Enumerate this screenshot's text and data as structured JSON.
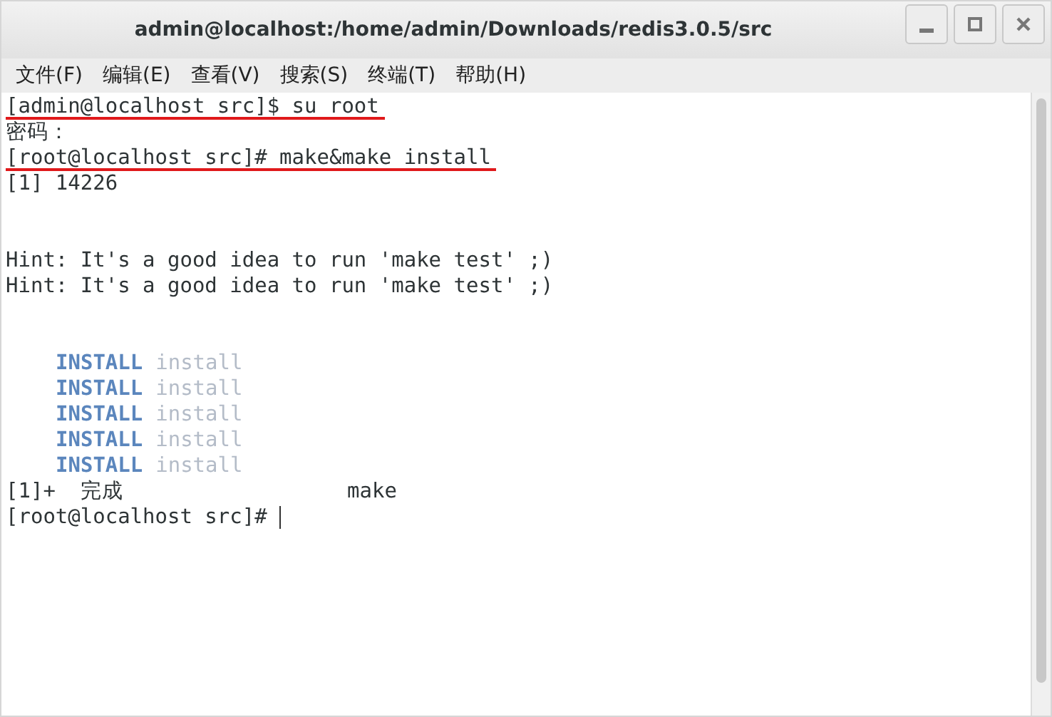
{
  "window": {
    "title": "admin@localhost:/home/admin/Downloads/redis3.0.5/src"
  },
  "menu": [
    "文件(F)",
    "编辑(E)",
    "查看(V)",
    "搜索(S)",
    "终端(T)",
    "帮助(H)"
  ],
  "terminal": {
    "lines": [
      {
        "kind": "underlined",
        "text": "[admin@localhost src]$ su root"
      },
      {
        "kind": "plain",
        "text": "密码："
      },
      {
        "kind": "underlined",
        "text": "[root@localhost src]# make&make install"
      },
      {
        "kind": "plain",
        "text": "[1] 14226"
      },
      {
        "kind": "blank"
      },
      {
        "kind": "blank"
      },
      {
        "kind": "plain",
        "text": "Hint: It's a good idea to run 'make test' ;)"
      },
      {
        "kind": "plain",
        "text": "Hint: It's a good idea to run 'make test' ;)"
      },
      {
        "kind": "blank"
      },
      {
        "kind": "blank"
      },
      {
        "kind": "install",
        "label": "INSTALL",
        "text": "install"
      },
      {
        "kind": "install",
        "label": "INSTALL",
        "text": "install"
      },
      {
        "kind": "install",
        "label": "INSTALL",
        "text": "install"
      },
      {
        "kind": "install",
        "label": "INSTALL",
        "text": "install"
      },
      {
        "kind": "install",
        "label": "INSTALL",
        "text": "install"
      },
      {
        "kind": "plain",
        "text": "[1]+  完成                  make"
      },
      {
        "kind": "prompt",
        "text": "[root@localhost src]# "
      }
    ]
  }
}
